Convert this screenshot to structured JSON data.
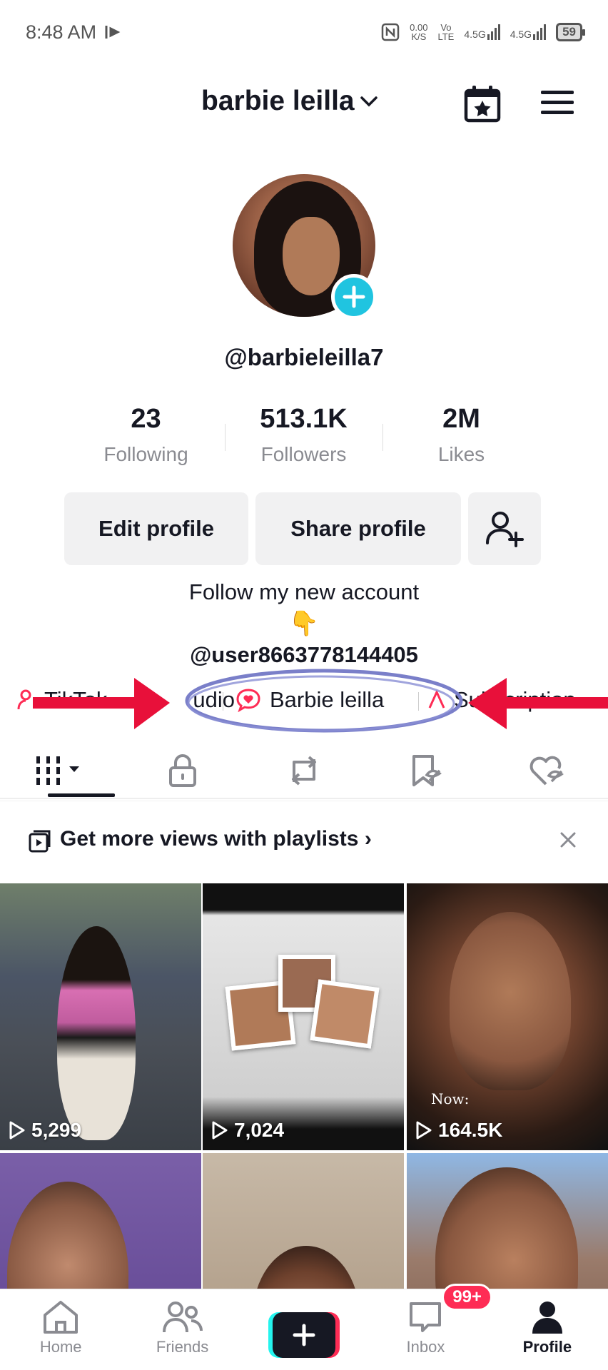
{
  "status_bar": {
    "time": "8:48 AM",
    "net_speed_value": "0.00",
    "net_speed_unit": "K/S",
    "volte_top": "Vo",
    "volte_bottom": "LTE",
    "signal1": "4.5G",
    "signal2": "4.5G",
    "battery": "59"
  },
  "header": {
    "title": "barbie leilla",
    "calendar_icon": "calendar-star-icon",
    "menu_icon": "hamburger-menu-icon"
  },
  "profile": {
    "handle": "@barbieleilla7",
    "stats": [
      {
        "value": "23",
        "label": "Following"
      },
      {
        "value": "513.1K",
        "label": "Followers"
      },
      {
        "value": "2M",
        "label": "Likes"
      }
    ],
    "buttons": {
      "edit": "Edit profile",
      "share": "Share profile"
    },
    "bio_line1": "Follow my new account",
    "bio_emoji": "👇",
    "bio_line2": "@user8663778144405"
  },
  "links": {
    "studio_left": "TikTok ",
    "studio_right": "udio",
    "barbie": "Barbie leilla",
    "subs": "Subscription"
  },
  "annotation": {
    "arrow_color": "#e8103a",
    "circle_color": "#7a7fc9"
  },
  "tabs": [
    {
      "icon": "videos-grid-icon"
    },
    {
      "icon": "lock-icon"
    },
    {
      "icon": "repost-icon"
    },
    {
      "icon": "favorites-icon"
    },
    {
      "icon": "liked-icon"
    }
  ],
  "playlist_banner": {
    "text": "Get more views with playlists",
    "chevron": "›"
  },
  "videos": [
    {
      "views": "5,299"
    },
    {
      "views": "7,024"
    },
    {
      "views": "164.5K",
      "overlay": "Now:"
    },
    {
      "views": ""
    },
    {
      "views": ""
    },
    {
      "views": ""
    }
  ],
  "nav": {
    "home": "Home",
    "friends": "Friends",
    "inbox": "Inbox",
    "inbox_badge": "99+",
    "profile": "Profile"
  },
  "colors": {
    "brand_cyan": "#25f4ee",
    "brand_red": "#fe2c55",
    "avatar_add": "#20c4e0"
  }
}
